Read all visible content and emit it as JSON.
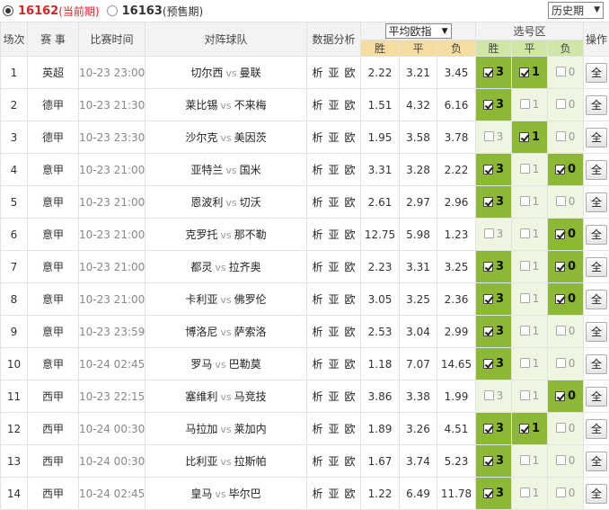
{
  "periods": [
    {
      "number": "16162",
      "tag": "(当前期)",
      "selected": true
    },
    {
      "number": "16163",
      "tag": "(预售期)",
      "selected": false
    }
  ],
  "history": {
    "label": "历史期"
  },
  "headers": {
    "index": "场次",
    "league": "赛 事",
    "time": "比赛时间",
    "teams": "对阵球队",
    "analysis": "数据分析",
    "odds_select": "平均欧指",
    "win": "胜",
    "draw": "平",
    "loss": "负",
    "pick_area": "选号区",
    "pick_win": "胜",
    "pick_draw": "平",
    "pick_loss": "负",
    "action": "操作"
  },
  "analysis_links": [
    "析",
    "亚",
    "欧"
  ],
  "vs_label": "vs",
  "all_label": "全",
  "pick_labels": {
    "win": "3",
    "draw": "1",
    "loss": "0"
  },
  "matches": [
    {
      "index": "1",
      "league": "英超",
      "time": "10-23 23:00",
      "home": "切尔西",
      "away": "曼联",
      "odds": [
        "2.22",
        "3.21",
        "3.45"
      ],
      "picks": [
        true,
        true,
        false
      ]
    },
    {
      "index": "2",
      "league": "德甲",
      "time": "10-23 21:30",
      "home": "莱比锡",
      "away": "不来梅",
      "odds": [
        "1.51",
        "4.32",
        "6.16"
      ],
      "picks": [
        true,
        false,
        false
      ]
    },
    {
      "index": "3",
      "league": "德甲",
      "time": "10-23 23:30",
      "home": "沙尔克",
      "away": "美因茨",
      "odds": [
        "1.95",
        "3.58",
        "3.78"
      ],
      "picks": [
        false,
        true,
        false
      ]
    },
    {
      "index": "4",
      "league": "意甲",
      "time": "10-23 21:00",
      "home": "亚特兰",
      "away": "国米",
      "odds": [
        "3.31",
        "3.28",
        "2.22"
      ],
      "picks": [
        true,
        false,
        true
      ]
    },
    {
      "index": "5",
      "league": "意甲",
      "time": "10-23 21:00",
      "home": "恩波利",
      "away": "切沃",
      "odds": [
        "2.61",
        "2.97",
        "2.96"
      ],
      "picks": [
        true,
        false,
        false
      ]
    },
    {
      "index": "6",
      "league": "意甲",
      "time": "10-23 21:00",
      "home": "克罗托",
      "away": "那不勒",
      "odds": [
        "12.75",
        "5.98",
        "1.23"
      ],
      "picks": [
        false,
        false,
        true
      ]
    },
    {
      "index": "7",
      "league": "意甲",
      "time": "10-23 21:00",
      "home": "都灵",
      "away": "拉齐奥",
      "odds": [
        "2.23",
        "3.31",
        "3.25"
      ],
      "picks": [
        true,
        false,
        true
      ]
    },
    {
      "index": "8",
      "league": "意甲",
      "time": "10-23 21:00",
      "home": "卡利亚",
      "away": "佛罗伦",
      "odds": [
        "3.05",
        "3.25",
        "2.36"
      ],
      "picks": [
        true,
        false,
        true
      ]
    },
    {
      "index": "9",
      "league": "意甲",
      "time": "10-23 23:59",
      "home": "博洛尼",
      "away": "萨索洛",
      "odds": [
        "2.53",
        "3.04",
        "2.99"
      ],
      "picks": [
        true,
        false,
        false
      ]
    },
    {
      "index": "10",
      "league": "意甲",
      "time": "10-24 02:45",
      "home": "罗马",
      "away": "巴勒莫",
      "odds": [
        "1.18",
        "7.07",
        "14.65"
      ],
      "picks": [
        true,
        false,
        false
      ]
    },
    {
      "index": "11",
      "league": "西甲",
      "time": "10-23 22:15",
      "home": "塞维利",
      "away": "马竞技",
      "odds": [
        "3.86",
        "3.38",
        "1.99"
      ],
      "picks": [
        false,
        false,
        true
      ]
    },
    {
      "index": "12",
      "league": "西甲",
      "time": "10-24 00:30",
      "home": "马拉加",
      "away": "莱加内",
      "odds": [
        "1.89",
        "3.26",
        "4.51"
      ],
      "picks": [
        true,
        true,
        false
      ]
    },
    {
      "index": "13",
      "league": "西甲",
      "time": "10-24 00:30",
      "home": "比利亚",
      "away": "拉斯帕",
      "odds": [
        "1.67",
        "3.74",
        "5.23"
      ],
      "picks": [
        true,
        false,
        false
      ]
    },
    {
      "index": "14",
      "league": "西甲",
      "time": "10-24 02:45",
      "home": "皇马",
      "away": "毕尔巴",
      "odds": [
        "1.22",
        "6.49",
        "11.78"
      ],
      "picks": [
        true,
        false,
        false
      ]
    }
  ],
  "colors": {
    "current_period": "#dd2222",
    "odds_header": "#f6dca0",
    "pick_header": "#cfe6a6",
    "pick_selected": "#8db836",
    "pick_unselected": "#eef6e2"
  }
}
